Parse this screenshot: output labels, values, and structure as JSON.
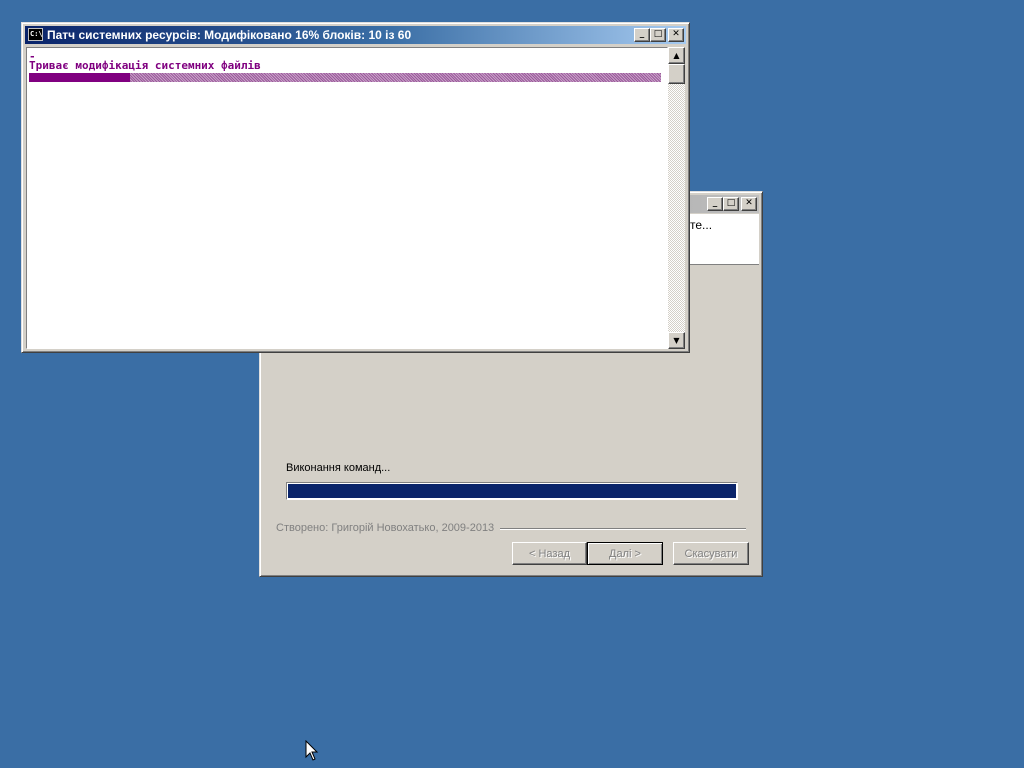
{
  "console": {
    "title": "Патч системних ресурсів:  Модифіковано 16%  блоків:  10  із  60",
    "icon": "cmd-icon",
    "cursor_line": "-",
    "message": "Триває модифікація системних файлів",
    "progress_fraction": 0.16,
    "caption_buttons": {
      "minimize": "_",
      "maximize": "□",
      "close": "✕"
    }
  },
  "installer": {
    "header_text": "те...",
    "status_label": "Виконання команд...",
    "progress_fraction": 1.0,
    "credit": "Створено: Григорій Новохатько, 2009-2013",
    "buttons": {
      "back": "< Назад",
      "next": "Далі >",
      "cancel": "Скасувати"
    },
    "caption_buttons": {
      "minimize": "_",
      "maximize": "□",
      "close": "✕"
    }
  },
  "colors": {
    "desktop": "#3a6ea5",
    "console_text": "#800080",
    "installer_progress": "#0a246a"
  }
}
